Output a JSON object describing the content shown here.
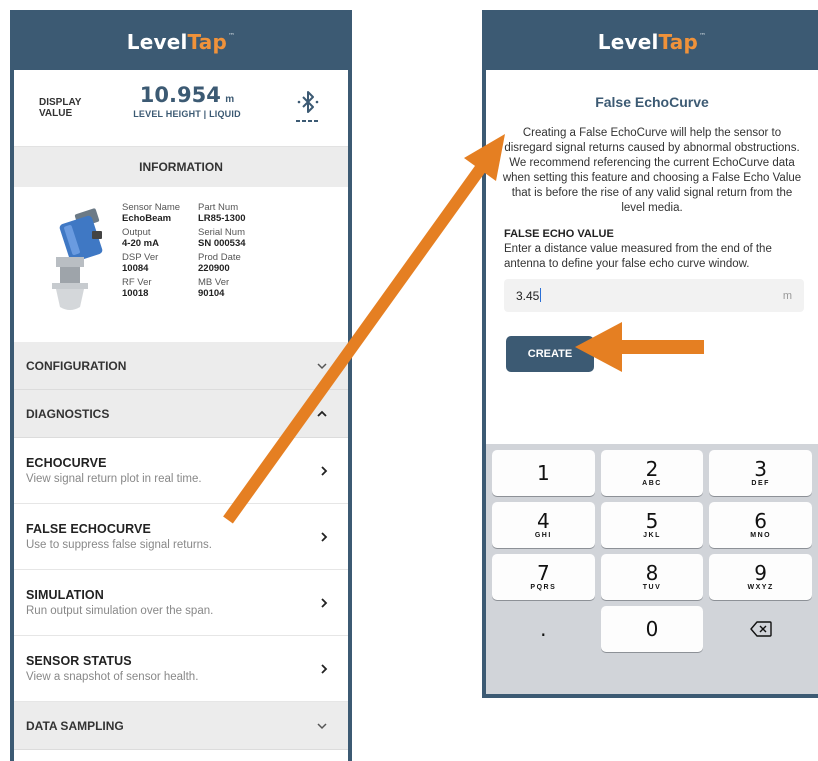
{
  "colors": {
    "brand": "#3c5a73",
    "accent": "#f0923a",
    "arrow": "#e57f22"
  },
  "left_phone": {
    "logo": {
      "main": "Level",
      "accent": "Tap",
      "tm": "™"
    },
    "display": {
      "label": "DISPLAY VALUE",
      "value": "10.954",
      "unit": "m",
      "sub": "LEVEL HEIGHT | LIQUID",
      "icon": "bluetooth-icon"
    },
    "information_title": "INFORMATION",
    "info": [
      {
        "k": "Sensor Name",
        "v": "EchoBeam"
      },
      {
        "k": "Part Num",
        "v": "LR85-1300"
      },
      {
        "k": "Output",
        "v": "4-20 mA"
      },
      {
        "k": "Serial Num",
        "v": "SN 000534"
      },
      {
        "k": "DSP Ver",
        "v": "10084"
      },
      {
        "k": "Prod Date",
        "v": "220900"
      },
      {
        "k": "RF Ver",
        "v": "10018"
      },
      {
        "k": "MB Ver",
        "v": "90104"
      }
    ],
    "configuration": "CONFIGURATION",
    "diagnostics": "DIAGNOSTICS",
    "items": [
      {
        "title": "ECHOCURVE",
        "desc": "View signal return plot in real time."
      },
      {
        "title": "FALSE ECHOCURVE",
        "desc": "Use to suppress false signal returns."
      },
      {
        "title": "SIMULATION",
        "desc": "Run output simulation over the span."
      },
      {
        "title": "SENSOR STATUS",
        "desc": "View a snapshot of sensor health."
      }
    ],
    "data_sampling": "DATA SAMPLING"
  },
  "right_phone": {
    "logo": {
      "main": "Level",
      "accent": "Tap",
      "tm": "™"
    },
    "title": "False EchoCurve",
    "description": "Creating a False EchoCurve will help the sensor to disregard signal returns caused by abnormal obstructions. We recommend referencing the current EchoCurve data when setting this feature and choosing a False Echo Value that is before the rise of any valid signal return from the level media.",
    "field_label": "FALSE ECHO VALUE",
    "field_help": "Enter a distance value measured from the end of the antenna to define your false echo curve window.",
    "input_value": "3.45",
    "input_unit": "m",
    "create_label": "CREATE",
    "keys": [
      {
        "num": "1",
        "letters": ""
      },
      {
        "num": "2",
        "letters": "ABC"
      },
      {
        "num": "3",
        "letters": "DEF"
      },
      {
        "num": "4",
        "letters": "GHI"
      },
      {
        "num": "5",
        "letters": "JKL"
      },
      {
        "num": "6",
        "letters": "MNO"
      },
      {
        "num": "7",
        "letters": "PQRS"
      },
      {
        "num": "8",
        "letters": "TUV"
      },
      {
        "num": "9",
        "letters": "WXYZ"
      },
      {
        "num": ".",
        "letters": ""
      },
      {
        "num": "0",
        "letters": ""
      },
      {
        "num": "",
        "letters": "",
        "icon": "backspace-icon"
      }
    ]
  }
}
